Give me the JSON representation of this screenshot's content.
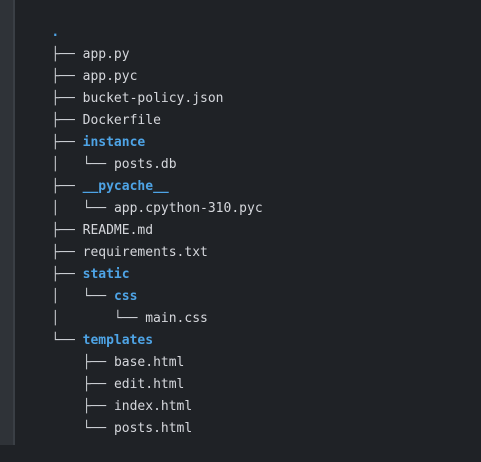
{
  "terminal": {
    "root": ".",
    "entries": [
      {
        "prefix": "├── ",
        "name": "app.py",
        "type": "file"
      },
      {
        "prefix": "├── ",
        "name": "app.pyc",
        "type": "file"
      },
      {
        "prefix": "├── ",
        "name": "bucket-policy.json",
        "type": "file"
      },
      {
        "prefix": "├── ",
        "name": "Dockerfile",
        "type": "file"
      },
      {
        "prefix": "├── ",
        "name": "instance",
        "type": "dir"
      },
      {
        "prefix": "│   └── ",
        "name": "posts.db",
        "type": "file"
      },
      {
        "prefix": "├── ",
        "name": "__pycache__",
        "type": "dir"
      },
      {
        "prefix": "│   └── ",
        "name": "app.cpython-310.pyc",
        "type": "file"
      },
      {
        "prefix": "├── ",
        "name": "README.md",
        "type": "file"
      },
      {
        "prefix": "├── ",
        "name": "requirements.txt",
        "type": "file"
      },
      {
        "prefix": "├── ",
        "name": "static",
        "type": "dir"
      },
      {
        "prefix": "│   └── ",
        "name": "css",
        "type": "dir"
      },
      {
        "prefix": "│       └── ",
        "name": "main.css",
        "type": "file"
      },
      {
        "prefix": "└── ",
        "name": "templates",
        "type": "dir"
      },
      {
        "prefix": "    ├── ",
        "name": "base.html",
        "type": "file"
      },
      {
        "prefix": "    ├── ",
        "name": "edit.html",
        "type": "file"
      },
      {
        "prefix": "    ├── ",
        "name": "index.html",
        "type": "file"
      },
      {
        "prefix": "    └── ",
        "name": "posts.html",
        "type": "file"
      }
    ]
  },
  "colors": {
    "background": "#1f2226",
    "text": "#d5d7dc",
    "directory": "#4ea4e6"
  }
}
